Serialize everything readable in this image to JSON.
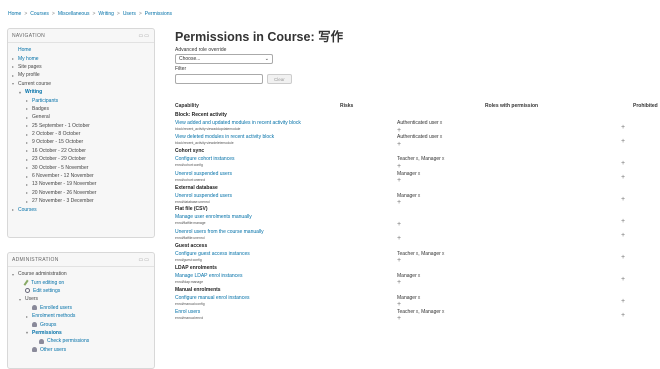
{
  "breadcrumb": [
    "Home",
    "Courses",
    "Miscellaneous",
    "Writing",
    "Users",
    "Permissions"
  ],
  "navigation": {
    "title": "NAVIGATION",
    "items": [
      {
        "label": "Home",
        "level": 0,
        "style": "link",
        "tri": ""
      },
      {
        "label": "My home",
        "level": 0,
        "style": "link",
        "tri": "▸"
      },
      {
        "label": "Site pages",
        "level": 0,
        "style": "plain",
        "tri": "▸"
      },
      {
        "label": "My profile",
        "level": 0,
        "style": "plain",
        "tri": "▸"
      },
      {
        "label": "Current course",
        "level": 0,
        "style": "plain",
        "tri": "▾"
      },
      {
        "label": "Writing",
        "level": 1,
        "style": "bold",
        "tri": "▾"
      },
      {
        "label": "Participants",
        "level": 2,
        "style": "link",
        "tri": "▸"
      },
      {
        "label": "Badges",
        "level": 2,
        "style": "plain",
        "tri": "▸"
      },
      {
        "label": "General",
        "level": 2,
        "style": "plain",
        "tri": "▸"
      },
      {
        "label": "25 September - 1 October",
        "level": 2,
        "style": "plain",
        "tri": "▸"
      },
      {
        "label": "2 October - 8 October",
        "level": 2,
        "style": "plain",
        "tri": "▸"
      },
      {
        "label": "9 October - 15 October",
        "level": 2,
        "style": "plain",
        "tri": "▸"
      },
      {
        "label": "16 October - 22 October",
        "level": 2,
        "style": "plain",
        "tri": "▸"
      },
      {
        "label": "23 October - 29 October",
        "level": 2,
        "style": "plain",
        "tri": "▸"
      },
      {
        "label": "30 October - 5 November",
        "level": 2,
        "style": "plain",
        "tri": "▸"
      },
      {
        "label": "6 November - 12 November",
        "level": 2,
        "style": "plain",
        "tri": "▸"
      },
      {
        "label": "13 November - 19 November",
        "level": 2,
        "style": "plain",
        "tri": "▸"
      },
      {
        "label": "20 November - 26 November",
        "level": 2,
        "style": "plain",
        "tri": "▸"
      },
      {
        "label": "27 November - 3 December",
        "level": 2,
        "style": "plain",
        "tri": "▸"
      },
      {
        "label": "Courses",
        "level": 0,
        "style": "link",
        "tri": "▸"
      }
    ]
  },
  "administration": {
    "title": "ADMINISTRATION",
    "items": [
      {
        "label": "Course administration",
        "level": 0,
        "style": "plain",
        "tri": "▾",
        "icon": ""
      },
      {
        "label": "Turn editing on",
        "level": 1,
        "style": "link",
        "tri": "",
        "icon": "pencil-icon"
      },
      {
        "label": "Edit settings",
        "level": 1,
        "style": "link",
        "tri": "",
        "icon": "gear-icon"
      },
      {
        "label": "Users",
        "level": 1,
        "style": "plain",
        "tri": "▾",
        "icon": ""
      },
      {
        "label": "Enrolled users",
        "level": 2,
        "style": "link",
        "tri": "",
        "icon": "people-icon"
      },
      {
        "label": "Enrolment methods",
        "level": 2,
        "style": "link",
        "tri": "▸",
        "icon": ""
      },
      {
        "label": "Groups",
        "level": 2,
        "style": "link",
        "tri": "",
        "icon": "people-icon"
      },
      {
        "label": "Permissions",
        "level": 2,
        "style": "bold",
        "tri": "▾",
        "icon": ""
      },
      {
        "label": "Check permissions",
        "level": 3,
        "style": "link",
        "tri": "",
        "icon": "people-icon"
      },
      {
        "label": "Other users",
        "level": 2,
        "style": "link",
        "tri": "",
        "icon": "people-icon"
      }
    ]
  },
  "main": {
    "title": "Permissions in Course: 写作",
    "override_label": "Advanced role override",
    "select_value": "Choose...",
    "filter_label": "Filter",
    "clear_label": "Clear",
    "headers": {
      "capability": "Capability",
      "risks": "Risks",
      "roles": "Roles with permission",
      "prohibited": "Prohibited"
    }
  },
  "rows": [
    {
      "type": "group",
      "label": "Block: Recent activity"
    },
    {
      "type": "cap",
      "label": "View added and updated modules in recent activity block",
      "code": "block/recent_activity:viewaddupdatemodule",
      "roles": [
        "Authenticated user"
      ]
    },
    {
      "type": "cap",
      "label": "View deleted modules in recent activity block",
      "code": "block/recent_activity:viewdeletemodule",
      "roles": [
        "Authenticated user"
      ]
    },
    {
      "type": "group",
      "label": "Cohort sync"
    },
    {
      "type": "cap",
      "label": "Configure cohort instances",
      "code": "enrol/cohort:config",
      "roles": [
        "Teacher",
        "Manager"
      ]
    },
    {
      "type": "cap",
      "label": "Unenrol suspended users",
      "code": "enrol/cohort:unenrol",
      "roles": [
        "Manager"
      ]
    },
    {
      "type": "group",
      "label": "External database"
    },
    {
      "type": "cap",
      "label": "Unenrol suspended users",
      "code": "enrol/database:unenrol",
      "roles": [
        "Manager"
      ]
    },
    {
      "type": "group",
      "label": "Flat file (CSV)"
    },
    {
      "type": "cap",
      "label": "Manage user enrolments manually",
      "code": "enrol/flatfile:manage",
      "roles": []
    },
    {
      "type": "cap",
      "label": "Unenrol users from the course manually",
      "code": "enrol/flatfile:unenrol",
      "roles": []
    },
    {
      "type": "group",
      "label": "Guest access"
    },
    {
      "type": "cap",
      "label": "Configure guest access instances",
      "code": "enrol/guest:config",
      "roles": [
        "Teacher",
        "Manager"
      ]
    },
    {
      "type": "group",
      "label": "LDAP enrolments"
    },
    {
      "type": "cap",
      "label": "Manage LDAP enrol instances",
      "code": "enrol/ldap:manage",
      "roles": [
        "Manager"
      ]
    },
    {
      "type": "group",
      "label": "Manual enrolments"
    },
    {
      "type": "cap",
      "label": "Configure manual enrol instances",
      "code": "enrol/manual:config",
      "roles": [
        "Manager"
      ]
    },
    {
      "type": "cap",
      "label": "Enrol users",
      "code": "enrol/manual:enrol",
      "roles": [
        "Teacher",
        "Manager"
      ]
    }
  ],
  "symbols": {
    "add": "+",
    "remove": "x"
  }
}
